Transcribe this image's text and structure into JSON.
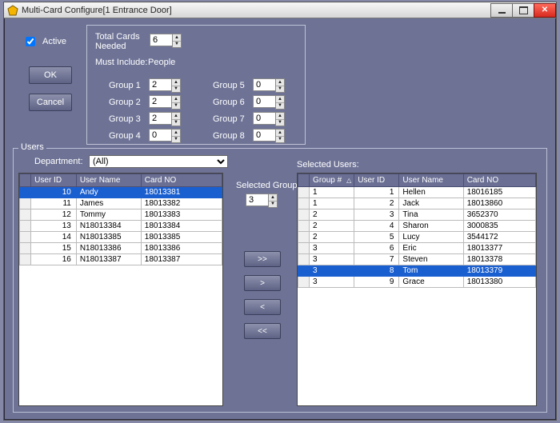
{
  "title": "Multi-Card Configure[1  Entrance Door]",
  "active_label": "Active",
  "active_checked": true,
  "buttons": {
    "ok": "OK",
    "cancel": "Cancel"
  },
  "panel": {
    "total_cards_label": "Total Cards\nNeeded",
    "total_cards": "6",
    "must_include_label": "Must Include:",
    "must_include_value": "People",
    "groups_left": [
      {
        "label": "Group 1",
        "val": "2"
      },
      {
        "label": "Group 2",
        "val": "2"
      },
      {
        "label": "Group 3",
        "val": "2"
      },
      {
        "label": "Group 4",
        "val": "0"
      }
    ],
    "groups_right": [
      {
        "label": "Group 5",
        "val": "0"
      },
      {
        "label": "Group 6",
        "val": "0"
      },
      {
        "label": "Group 7",
        "val": "0"
      },
      {
        "label": "Group 8",
        "val": "0"
      }
    ]
  },
  "users_legend": "Users",
  "dept_label": "Department:",
  "dept_value": "(All)",
  "left_table": {
    "headers": [
      "User ID",
      "User Name",
      "Card NO"
    ],
    "selected_index": 0,
    "rows": [
      {
        "id": "10",
        "name": "Andy",
        "card": "18013381"
      },
      {
        "id": "11",
        "name": "James",
        "card": "18013382"
      },
      {
        "id": "12",
        "name": "Tommy",
        "card": "18013383"
      },
      {
        "id": "13",
        "name": "N18013384",
        "card": "18013384"
      },
      {
        "id": "14",
        "name": "N18013385",
        "card": "18013385"
      },
      {
        "id": "15",
        "name": "N18013386",
        "card": "18013386"
      },
      {
        "id": "16",
        "name": "N18013387",
        "card": "18013387"
      }
    ]
  },
  "selected_users_label": "Selected Users:",
  "selected_group_label": "Selected Group #",
  "selected_group_value": "3",
  "xfer": {
    "add_all": ">>",
    "add": ">",
    "remove": "<",
    "remove_all": "<<"
  },
  "right_table": {
    "headers": [
      "Group #",
      "User ID",
      "User Name",
      "Card NO"
    ],
    "sort_col": 0,
    "selected_index": 7,
    "rows": [
      {
        "grp": "1",
        "id": "1",
        "name": "Hellen",
        "card": "18016185"
      },
      {
        "grp": "1",
        "id": "2",
        "name": "Jack",
        "card": "18013860"
      },
      {
        "grp": "2",
        "id": "3",
        "name": "Tina",
        "card": "3652370"
      },
      {
        "grp": "2",
        "id": "4",
        "name": "Sharon",
        "card": "3000835"
      },
      {
        "grp": "2",
        "id": "5",
        "name": "Lucy",
        "card": "3544172"
      },
      {
        "grp": "3",
        "id": "6",
        "name": "Eric",
        "card": "18013377"
      },
      {
        "grp": "3",
        "id": "7",
        "name": "Steven",
        "card": "18013378"
      },
      {
        "grp": "3",
        "id": "8",
        "name": "Tom",
        "card": "18013379"
      },
      {
        "grp": "3",
        "id": "9",
        "name": "Grace",
        "card": "18013380"
      }
    ]
  }
}
